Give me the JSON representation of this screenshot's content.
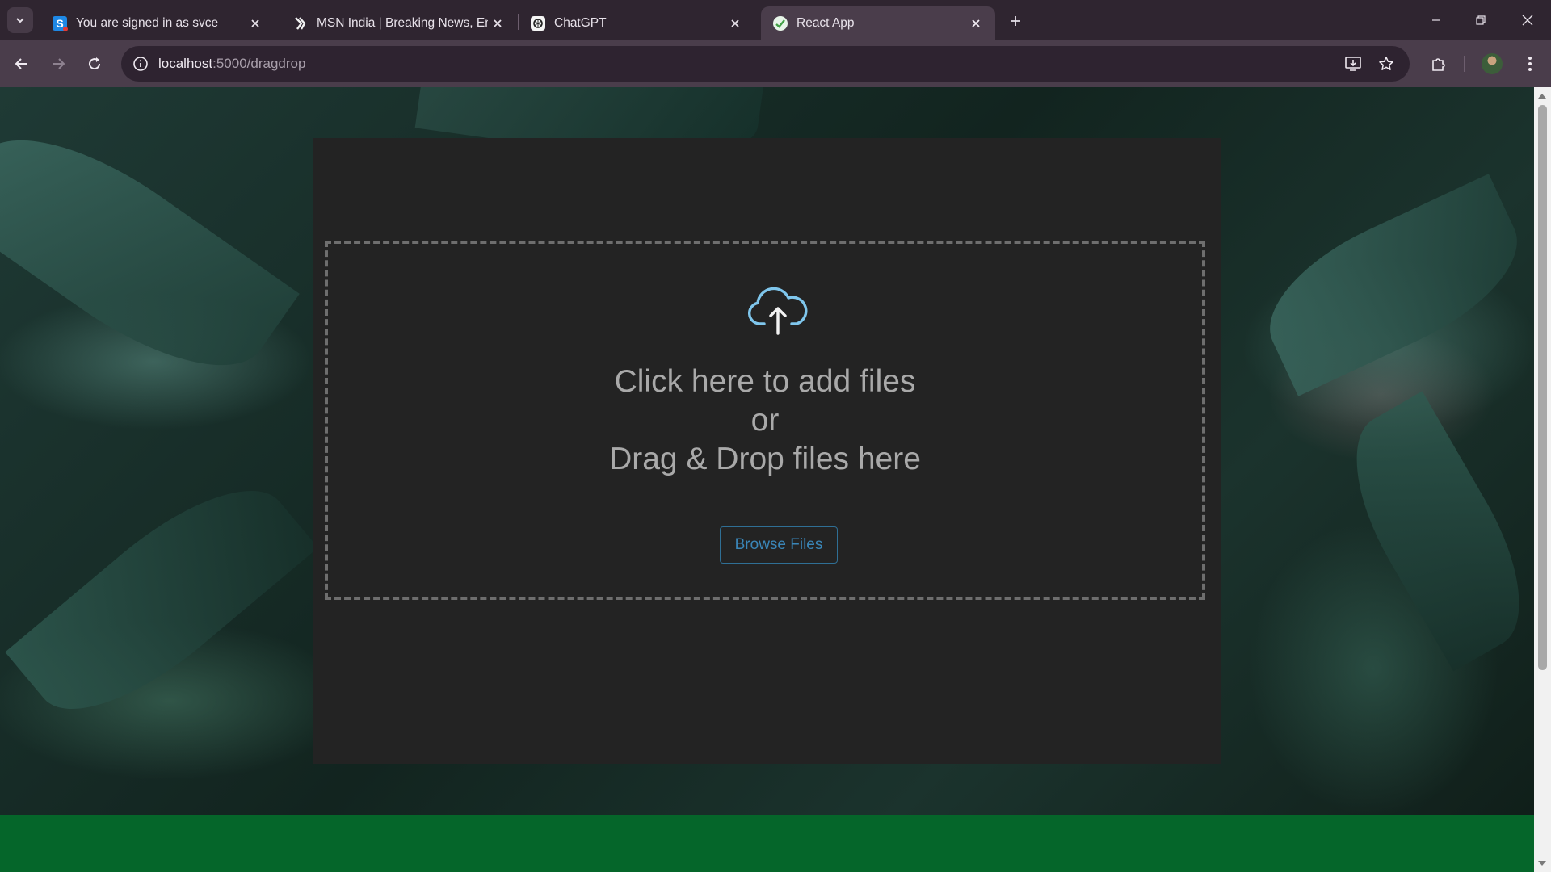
{
  "browser": {
    "tabs": [
      {
        "title": "You are signed in as svce",
        "favicon": "s-letter-icon",
        "active": false
      },
      {
        "title": "MSN India | Breaking News, Ent",
        "favicon": "msn-icon",
        "active": false
      },
      {
        "title": "ChatGPT",
        "favicon": "chatgpt-icon",
        "active": false
      },
      {
        "title": "React App",
        "favicon": "react-icon",
        "active": true
      }
    ],
    "address": {
      "host": "localhost",
      "path": ":5000/dragdrop"
    }
  },
  "dropzone": {
    "line1": "Click here to add files",
    "line2": "or",
    "line3": "Drag & Drop files here",
    "browse_label": "Browse Files"
  },
  "colors": {
    "icon_blue": "#7fc6ec",
    "button_blue": "#3a86b8",
    "footer_green": "#05662a",
    "card_bg": "#232323"
  }
}
